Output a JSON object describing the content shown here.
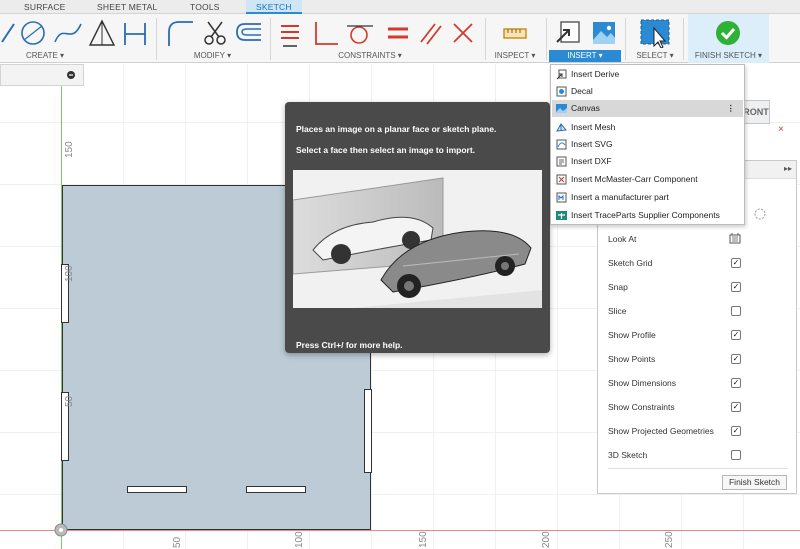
{
  "tabs": [
    "SURFACE",
    "SHEET METAL",
    "TOOLS",
    "SKETCH"
  ],
  "ribbon": {
    "groups": {
      "create": "CREATE ▾",
      "modify": "MODIFY ▾",
      "constraints": "CONSTRAINTS ▾",
      "inspect": "INSPECT ▾",
      "insert": "INSERT ▾",
      "select": "SELECT ▾",
      "finish": "FINISH SKETCH ▾"
    }
  },
  "view_label": "RONT",
  "rulers": {
    "y": [
      "150",
      "100",
      "50"
    ],
    "x": [
      "50",
      "100",
      "150",
      "200",
      "250"
    ]
  },
  "tooltip": {
    "line1": "Places an image on a planar face or sketch plane.",
    "line2": "Select a face then select an image to import.",
    "line3": "Press Ctrl+/ for more help."
  },
  "insert_menu": {
    "items": [
      {
        "label": "Insert Derive",
        "icon": "derive-icon"
      },
      {
        "label": "Decal",
        "icon": "decal-icon"
      },
      {
        "label": "Canvas",
        "icon": "canvas-icon"
      },
      {
        "label": "Insert Mesh",
        "icon": "mesh-icon"
      },
      {
        "label": "Insert SVG",
        "icon": "svg-icon"
      },
      {
        "label": "Insert DXF",
        "icon": "dxf-icon"
      },
      {
        "label": "Insert McMaster-Carr Component",
        "icon": "mcmaster-icon"
      },
      {
        "label": "Insert a manufacturer part",
        "icon": "manufacturer-icon"
      },
      {
        "label": "Insert TraceParts Supplier Components",
        "icon": "traceparts-icon"
      }
    ]
  },
  "panel": {
    "rows": [
      {
        "label": "Look At",
        "checked": null
      },
      {
        "label": "Sketch Grid",
        "checked": true
      },
      {
        "label": "Snap",
        "checked": true
      },
      {
        "label": "Slice",
        "checked": false
      },
      {
        "label": "Show Profile",
        "checked": true
      },
      {
        "label": "Show Points",
        "checked": true
      },
      {
        "label": "Show Dimensions",
        "checked": true
      },
      {
        "label": "Show Constraints",
        "checked": true
      },
      {
        "label": "Show Projected Geometries",
        "checked": true
      },
      {
        "label": "3D Sketch",
        "checked": false
      }
    ],
    "finish_button": "Finish Sketch"
  },
  "colors": {
    "accent": "#2a8ad4",
    "profile_fill": "#bccbd6",
    "finish_check": "#2eb135"
  }
}
